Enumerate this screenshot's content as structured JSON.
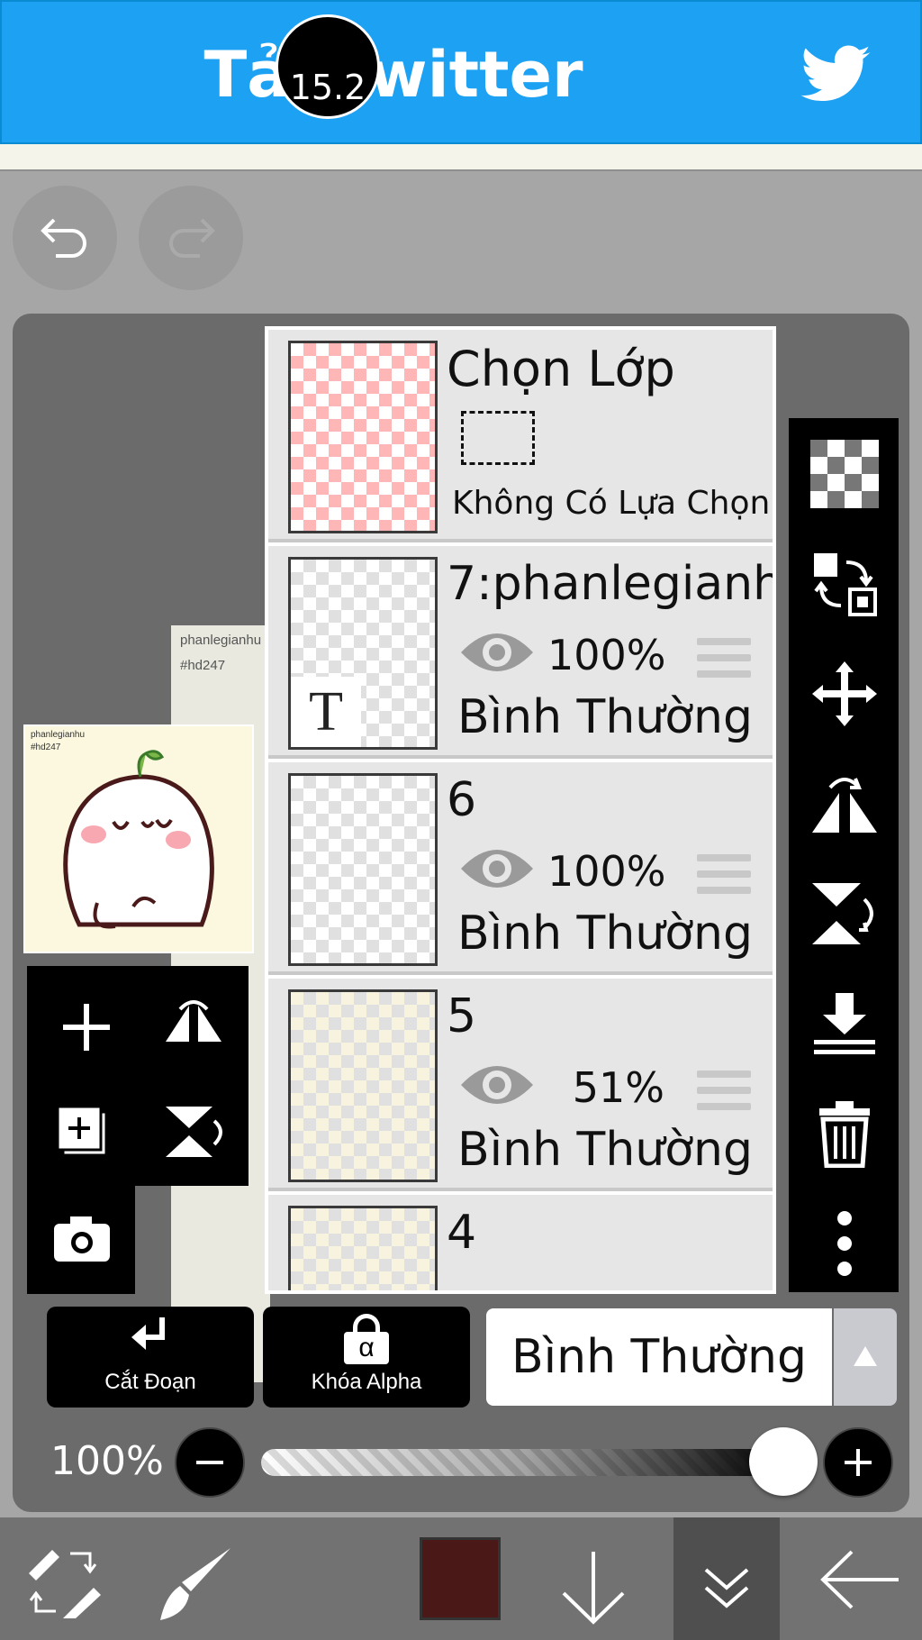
{
  "banner": {
    "title": "Tải Twitter",
    "icon": "twitter-bird-icon"
  },
  "history": {
    "undo_icon": "undo-icon",
    "redo_icon": "redo-icon"
  },
  "canvas": {
    "paper_line1": "phanlegianhu",
    "paper_line2": "#hd247"
  },
  "layers_panel": {
    "selection": {
      "title": "Chọn Lớp",
      "status": "Không Có Lựa Chọn"
    },
    "layers": [
      {
        "name": "7:phanlegianh",
        "opacity": "100%",
        "blend": "Bình Thường",
        "thumb_badge": "T"
      },
      {
        "name": "6",
        "opacity": "100%",
        "blend": "Bình Thường"
      },
      {
        "name": "5",
        "opacity": "51%",
        "blend": "Bình Thường"
      },
      {
        "name": "4"
      }
    ]
  },
  "actions": {
    "clipping_label": "Cắt Đoạn",
    "alpha_lock_label": "Khóa Alpha",
    "alpha_symbol": "α",
    "blend_mode": "Bình Thường"
  },
  "opacity": {
    "label": "100%",
    "value": 1.0
  },
  "bottom_bar": {
    "brush_size": "15.2",
    "color": "#4b1818"
  },
  "colors": {
    "accent": "#1da1f2",
    "panel": "#e6e6e6",
    "toolbar": "#000000"
  }
}
